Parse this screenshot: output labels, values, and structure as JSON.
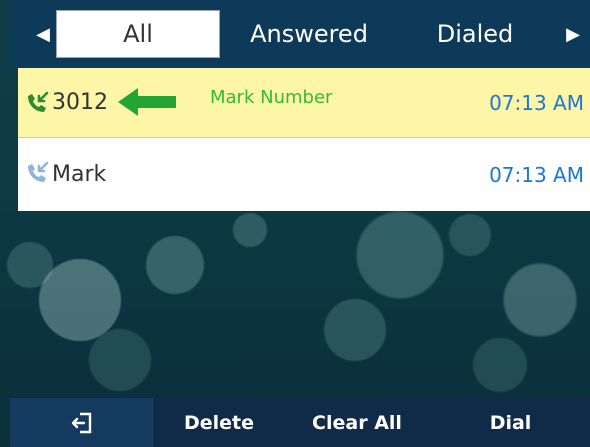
{
  "tabs": {
    "items": [
      {
        "label": "All",
        "active": true
      },
      {
        "label": "Answered",
        "active": false
      },
      {
        "label": "Dialed",
        "active": false
      }
    ]
  },
  "calls": [
    {
      "name": "3012",
      "note": "Mark Number",
      "time": "07:13 AM",
      "type": "incoming",
      "selected": true
    },
    {
      "name": "Mark",
      "time": "07:13 AM",
      "type": "incoming",
      "selected": false
    }
  ],
  "softkeys": {
    "back_icon": "exit-icon",
    "delete": "Delete",
    "clear_all": "Clear All",
    "dial": "Dial"
  },
  "colors": {
    "tabbar": "#0e3a5a",
    "selected_row": "#fef6a7",
    "time": "#1a77d6",
    "note": "#33bb33",
    "softkey_bar": "#0f2b47"
  }
}
